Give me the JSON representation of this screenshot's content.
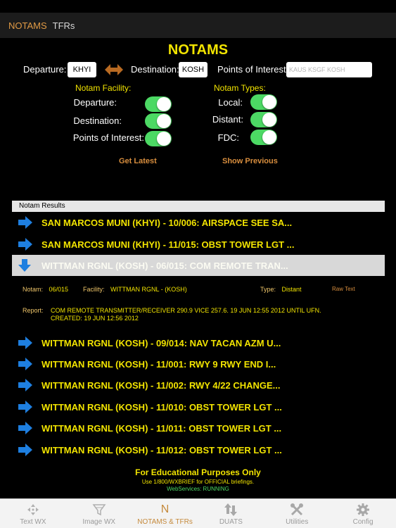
{
  "topbar": {
    "tabs": [
      {
        "label": "NOTAMS"
      },
      {
        "label": "TFRs"
      }
    ]
  },
  "page_title": "NOTAMS",
  "route": {
    "departure_label": "Departure:",
    "departure_value": "KHYI",
    "destination_label": "Destination:",
    "destination_value": "KOSH",
    "poi_label": "Points of Interest:",
    "poi_placeholder": "KAUS KSGF KOSH"
  },
  "facility": {
    "heading": "Notam Facility:",
    "options": [
      {
        "label": "Departure:",
        "on": true
      },
      {
        "label": "Destination:",
        "on": true
      },
      {
        "label": "Points of Interest:",
        "on": true
      }
    ]
  },
  "types": {
    "heading": "Notam Types:",
    "options": [
      {
        "label": "Local:",
        "on": true
      },
      {
        "label": "Distant:",
        "on": true
      },
      {
        "label": "FDC:",
        "on": true
      }
    ]
  },
  "actions": {
    "get_latest": "Get Latest",
    "show_previous": "Show Previous"
  },
  "results": {
    "header": "Notam Results",
    "items": [
      {
        "text": "SAN MARCOS MUNI (KHYI) - 10/006: AIRSPACE SEE SA..."
      },
      {
        "text": "SAN MARCOS MUNI (KHYI) - 11/015: OBST TOWER LGT ..."
      },
      {
        "text": "WITTMAN RGNL (KOSH) - 06/015: COM REMOTE TRAN..."
      },
      {
        "text": "WITTMAN RGNL (KOSH) - 09/014: NAV TACAN AZM U..."
      },
      {
        "text": "WITTMAN RGNL (KOSH) - 11/001: RWY 9 RWY END I..."
      },
      {
        "text": "WITTMAN RGNL (KOSH) - 11/002: RWY 4/22 CHANGE..."
      },
      {
        "text": "WITTMAN RGNL (KOSH) - 11/010: OBST TOWER LGT ..."
      },
      {
        "text": "WITTMAN RGNL (KOSH) - 11/011: OBST TOWER LGT ..."
      },
      {
        "text": "WITTMAN RGNL (KOSH) - 11/012: OBST TOWER LGT ..."
      }
    ]
  },
  "detail": {
    "notam_label": "Notam:",
    "notam_value": "06/015",
    "facility_label": "Facility:",
    "facility_value": "WITTMAN RGNL - (KOSH)",
    "type_label": "Type:",
    "type_value": "Distant",
    "raw_text": "Raw Text",
    "report_label": "Report:",
    "report_line1": "COM REMOTE TRANSMITTER/RECEIVER 290.9 VICE 257.6. 19 JUN 12:55 2012 UNTIL UFN.",
    "report_line2": "CREATED: 19 JUN 12:56 2012"
  },
  "footer": {
    "line1": "For Educational Purposes Only",
    "line2": "Use 1/800/WXBRIEF for OFFICIAL briefings.",
    "line3": "WebServices: RUNNING"
  },
  "tabbar": {
    "items": [
      {
        "label": "Text WX",
        "icon": "crosshair-icon"
      },
      {
        "label": "Image WX",
        "icon": "funnel-icon"
      },
      {
        "label": "NOTAMS & TFRs",
        "icon": "n-letter-icon",
        "glyph": "N"
      },
      {
        "label": "DUATS",
        "icon": "transfer-arrows-icon"
      },
      {
        "label": "Utilities",
        "icon": "tools-icon"
      },
      {
        "label": "Config",
        "icon": "gear-icon"
      }
    ]
  },
  "colors": {
    "accent_yellow": "#f2e400",
    "accent_orange": "#d88e3e",
    "toggle_green": "#4cd964"
  }
}
